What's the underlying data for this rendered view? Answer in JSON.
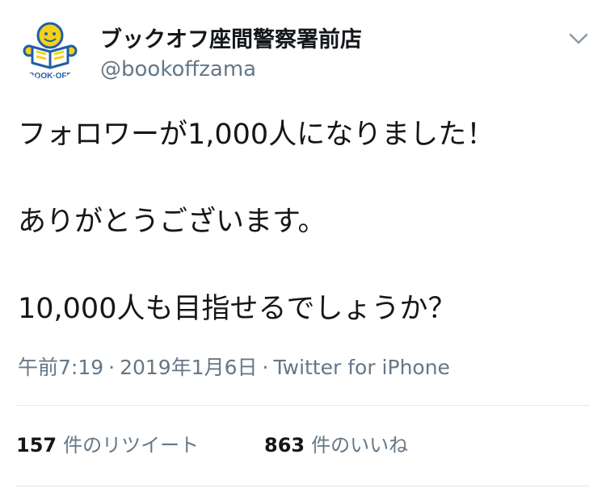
{
  "account": {
    "display_name": "ブックオフ座間警察署前店",
    "handle": "@bookoffzama",
    "avatar_icon": "bookoff-logo-icon",
    "avatar_text": "BOOK·OFF",
    "brand_colors": {
      "yellow": "#f7d117",
      "blue": "#1f5fa8"
    }
  },
  "header": {
    "menu_icon": "chevron-down-icon"
  },
  "tweet": {
    "lines": [
      "フォロワーが1,000人になりました！",
      "ありがとうございます。",
      "10,000人も目指せるでしょうか？"
    ],
    "time": "午前7:19",
    "date": "2019年1月6日",
    "source": "Twitter for iPhone",
    "separator": "·"
  },
  "stats": {
    "retweets_count": "157",
    "retweets_label": "件のリツイート",
    "likes_count": "863",
    "likes_label": "件のいいね"
  }
}
